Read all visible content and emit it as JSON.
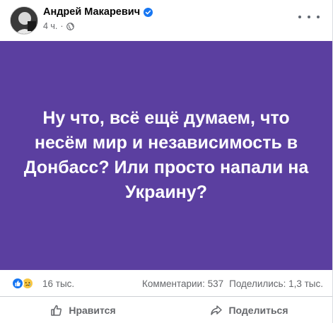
{
  "post": {
    "author": "Андрей Макаревич",
    "time": "4 ч.",
    "text": "Ну что, всё ещё думаем, что несём мир и независимость в Донбасс? Или просто напали на Украину?",
    "background_color": "#5b3fa0"
  },
  "reactions": {
    "icons": [
      "like-icon",
      "sad-icon"
    ],
    "count": "16 тыс.",
    "comments": "Комментарии: 537",
    "shares": "Поделились: 1,3 тыс."
  },
  "actions": {
    "like_label": "Нравится",
    "share_label": "Поделиться"
  },
  "colors": {
    "accent": "#1877f2",
    "muted_text": "#65676b"
  }
}
